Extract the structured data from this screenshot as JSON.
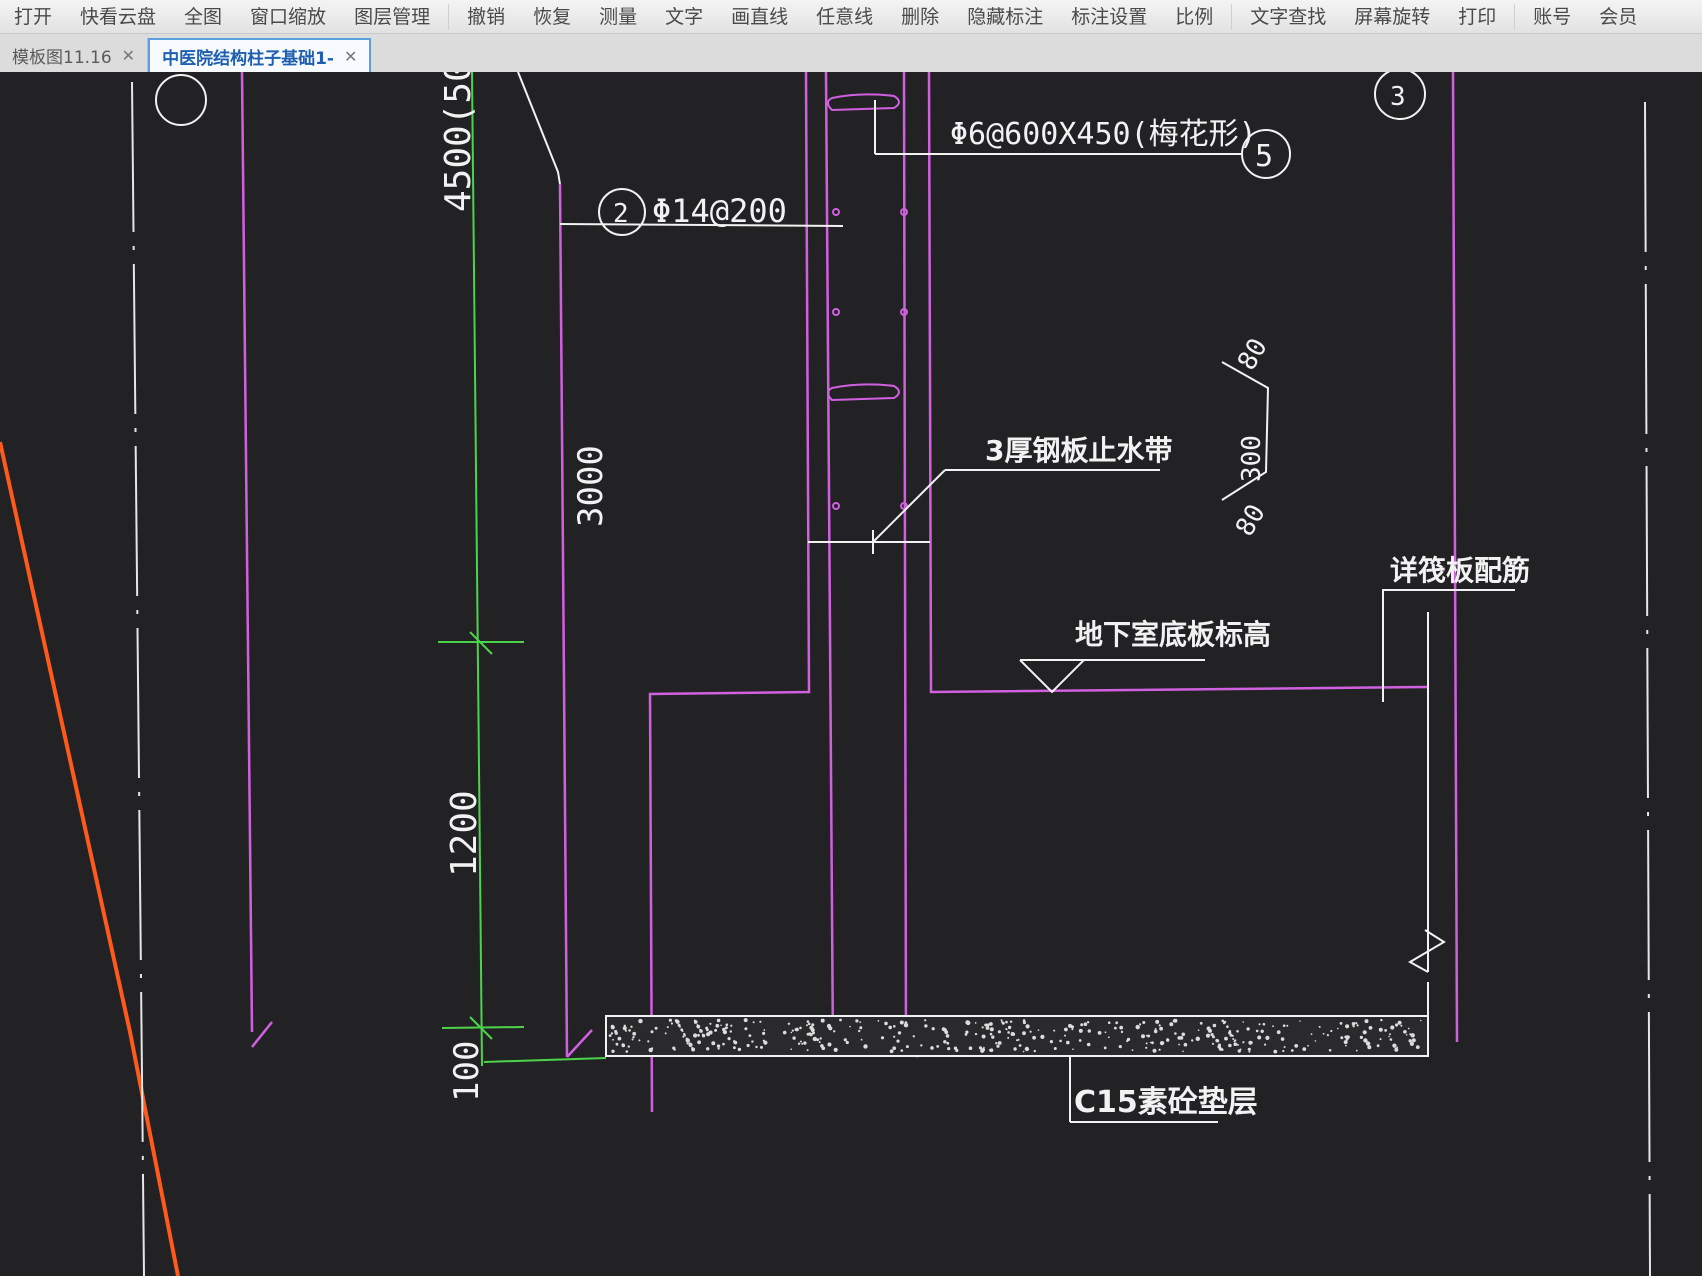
{
  "toolbar": {
    "items": [
      "打开",
      "快看云盘",
      "全图",
      "窗口缩放",
      "图层管理",
      "撤销",
      "恢复",
      "测量",
      "文字",
      "画直线",
      "任意线",
      "删除",
      "隐藏标注",
      "标注设置",
      "比例",
      "文字查找",
      "屏幕旋转",
      "打印",
      "账号",
      "会员"
    ]
  },
  "tabs": [
    {
      "label": "模板图11.16",
      "active": false
    },
    {
      "label": "中医院结构柱子基础1-",
      "active": true
    }
  ],
  "drawing": {
    "colors": {
      "background": "#222224",
      "wall": "#d060e0",
      "dimension": "#4cd34c",
      "annotation": "#f2f2f2",
      "orange": "#ff5a1a"
    },
    "dim_texts": {
      "top": "4500(50",
      "mid": "1200",
      "bottom": "100",
      "wall_height": "3000"
    },
    "rebar_label_2": {
      "num": "2",
      "text": "Φ14@200"
    },
    "tie_label_5": {
      "num": "5",
      "text": "Φ6@600X450(梅花形)"
    },
    "axis_label_3": "3",
    "waterstop_label": "3厚钢板止水带",
    "waterstop_dims": {
      "top": "80",
      "mid": "300",
      "bottom": "80"
    },
    "basement_slab_label": "地下室底板标高",
    "raft_rebar_label": "详筏板配筋",
    "cushion_label": "C15素砼垫层"
  }
}
